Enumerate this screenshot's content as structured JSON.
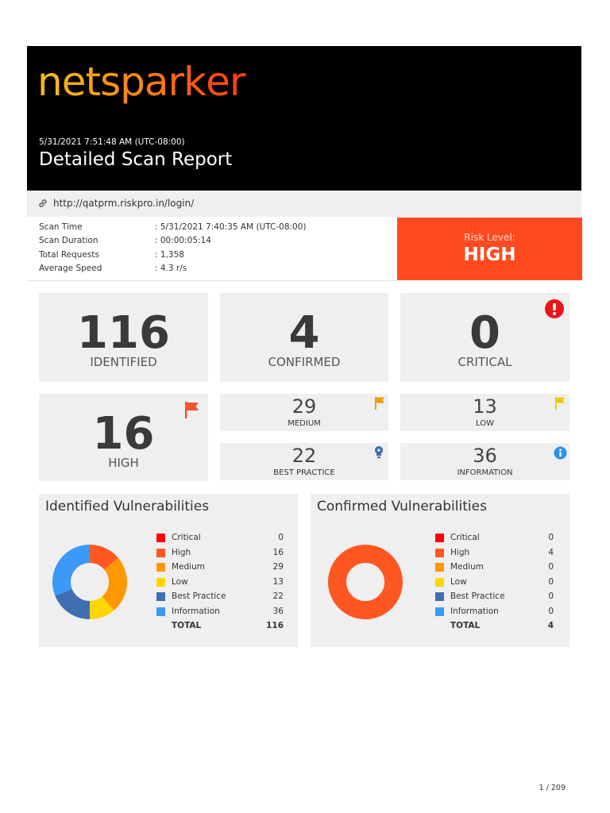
{
  "header": {
    "logo_text": [
      "n",
      "e",
      "t",
      "s",
      "p",
      "a",
      "r",
      "k",
      "e",
      "r"
    ],
    "logo_colors": [
      "#f6b818",
      "#f7ac17",
      "#f8a016",
      "#f99415",
      "#fa8614",
      "#fb7713",
      "#fc6812",
      "#fd5a12",
      "#fe4c11",
      "#ff4010"
    ],
    "scan_date": "5/31/2021 7:51:48 AM (UTC-08:00)",
    "title": "Detailed Scan Report"
  },
  "url": "http://qatprm.riskpro.in/login/",
  "scan_info": [
    {
      "label": "Scan Time",
      "value": ": 5/31/2021 7:40:35 AM (UTC-08:00)"
    },
    {
      "label": "Scan Duration",
      "value": ": 00:00:05:14"
    },
    {
      "label": "Total Requests",
      "value": ": 1,358"
    },
    {
      "label": "Average Speed",
      "value": ": 4.3 r/s"
    }
  ],
  "risk": {
    "label": "Risk Level:",
    "value": "HIGH",
    "color": "#ff4a1f"
  },
  "summary": {
    "identified": {
      "count": "116",
      "label": "IDENTIFIED"
    },
    "confirmed": {
      "count": "4",
      "label": "CONFIRMED"
    },
    "critical": {
      "count": "0",
      "label": "CRITICAL",
      "icon": "exclamation-circle-icon",
      "icon_color": "#e8151b"
    },
    "high": {
      "count": "16",
      "label": "HIGH",
      "icon": "flag-icon",
      "icon_color": "#f2522c"
    },
    "medium": {
      "count": "29",
      "label": "MEDIUM",
      "icon": "flag-icon",
      "icon_color": "#f59a00"
    },
    "low": {
      "count": "13",
      "label": "LOW",
      "icon": "flag-icon",
      "icon_color": "#f4c800"
    },
    "best_practice": {
      "count": "22",
      "label": "BEST PRACTICE",
      "icon": "lightbulb-icon",
      "icon_color": "#3a6fb0"
    },
    "information": {
      "count": "36",
      "label": "INFORMATION",
      "icon": "info-circle-icon",
      "icon_color": "#2f8ff0"
    }
  },
  "identified_panel": {
    "title": "Identified Vulnerabilities",
    "rows": [
      {
        "name": "Critical",
        "count": "0",
        "color": "#ff0000"
      },
      {
        "name": "High",
        "count": "16",
        "color": "#ff5722"
      },
      {
        "name": "Medium",
        "count": "29",
        "color": "#ff9800"
      },
      {
        "name": "Low",
        "count": "13",
        "color": "#ffd600"
      },
      {
        "name": "Best Practice",
        "count": "22",
        "color": "#3f6fb0"
      },
      {
        "name": "Information",
        "count": "36",
        "color": "#3b99f7"
      }
    ],
    "total_label": "TOTAL",
    "total": "116"
  },
  "confirmed_panel": {
    "title": "Confirmed Vulnerabilities",
    "rows": [
      {
        "name": "Critical",
        "count": "0",
        "color": "#ff0000"
      },
      {
        "name": "High",
        "count": "4",
        "color": "#ff5722"
      },
      {
        "name": "Medium",
        "count": "0",
        "color": "#ff9800"
      },
      {
        "name": "Low",
        "count": "0",
        "color": "#ffd600"
      },
      {
        "name": "Best Practice",
        "count": "0",
        "color": "#3f6fb0"
      },
      {
        "name": "Information",
        "count": "0",
        "color": "#3b99f7"
      }
    ],
    "total_label": "TOTAL",
    "total": "4"
  },
  "page_number": "1 / 209"
}
